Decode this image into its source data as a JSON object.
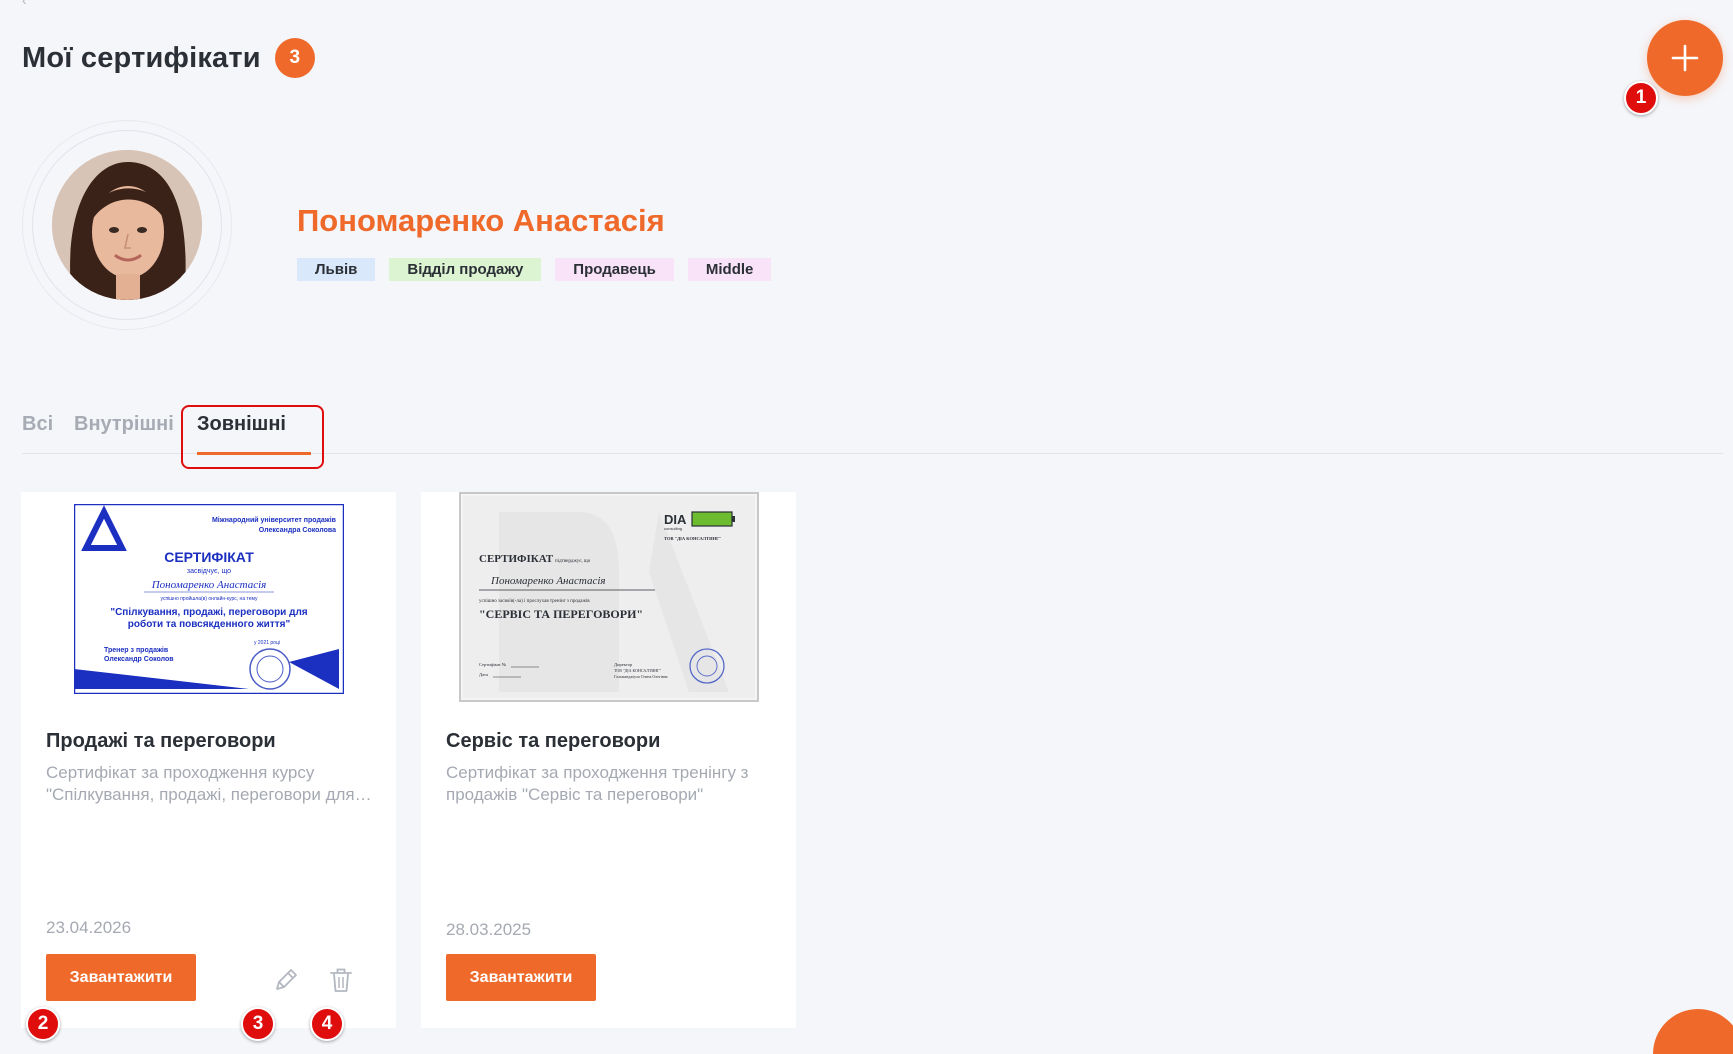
{
  "header": {
    "title": "Мої сертифікати",
    "count": "3"
  },
  "profile": {
    "name": "Пономаренко Анастасія",
    "tags": {
      "city": "Львів",
      "department": "Відділ продажу",
      "role": "Продавець",
      "level": "Middle"
    }
  },
  "tabs": {
    "all": "Всі",
    "internal": "Внутрішні",
    "external": "Зовнішні",
    "active": "external"
  },
  "markers": [
    "1",
    "2",
    "3",
    "4"
  ],
  "cards": [
    {
      "title": "Продажі та переговори",
      "desc_line1": "Сертифікат за проходження курсу",
      "desc_line2": "\"Спілкування, продажі, переговори для роботи та повсякденного життя\"",
      "date": "23.04.2026",
      "download_label": "Завантажити",
      "thumb": {
        "org_line1": "Міжнародний університет продажів",
        "org_line2": "Олександра Соколова",
        "heading": "СЕРТИФІКАТ",
        "certifies": "засвідчує, що",
        "person": "Пономаренко Анастасія",
        "completed": "успішно пройшла(в) онлайн-курс, на тему",
        "course_line1": "\"Спілкування, продажі, переговори для",
        "course_line2": "роботи та повсякденного життя\"",
        "trainer_line1": "Тренер з продажів",
        "trainer_line2": "Олександр Соколов",
        "year": "у 2021 році"
      }
    },
    {
      "title": "Сервіс та переговори",
      "desc_line1": "Сертифікат за проходження тренінгу з",
      "desc_line2": "продажів \"Сервіс та переговори\"",
      "date": "28.03.2025",
      "download_label": "Завантажити",
      "thumb": {
        "brand": "DIA",
        "brand_sub": "consulting",
        "company": "ТОВ \"ДІА КОНСАЛТИНГ\"",
        "heading": "СЕРТИФІКАТ",
        "confirms": "підтверджує, що",
        "person": "Пономаренко Анастасія",
        "completed": "успішно засвоїв(-ла) і прослухав тренінг з продажів",
        "course": "\"СЕРВІС ТА ПЕРЕГОВОРИ\"",
        "cert_no": "Сертифікат №",
        "date_label": "Дата",
        "director": "Директор",
        "director_company": "ТОВ \"ДІА КОНСАЛТИНГ\"",
        "director_name": "Гальманджіула Олена Олегівна"
      }
    }
  ],
  "colors": {
    "accent": "#ef6a2a",
    "marker": "#e00d0d"
  }
}
